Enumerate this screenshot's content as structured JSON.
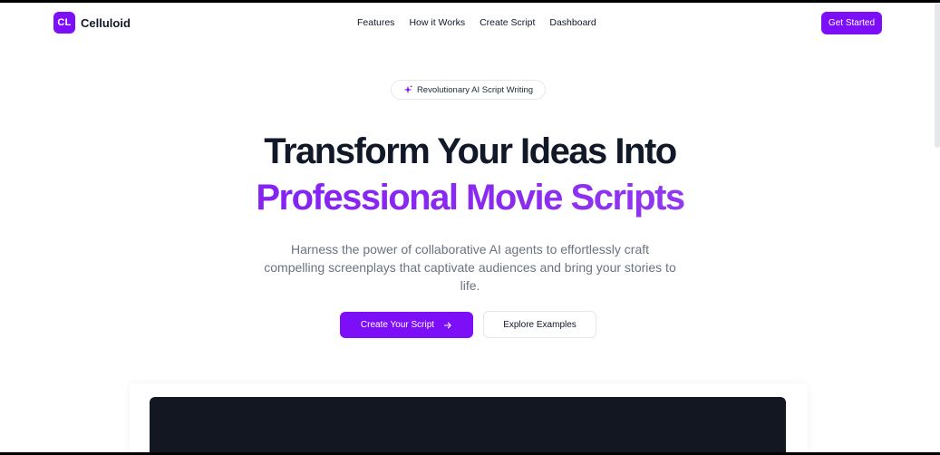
{
  "nav": {
    "logo_badge": "CL",
    "logo_text": "Celluloid",
    "links": [
      "Features",
      "How it Works",
      "Create Script",
      "Dashboard"
    ],
    "cta": "Get Started"
  },
  "hero": {
    "pill_text": "Revolutionary AI Script Writing",
    "pill_icon": "sparkle-icon",
    "headline_line1": "Transform Your Ideas Into",
    "headline_line2": "Professional Movie Scripts",
    "subtext": "Harness the power of collaborative AI agents to effortlessly craft compelling screenplays that captivate audiences and bring your stories to life.",
    "primary_button": "Create Your Script",
    "primary_icon": "arrow-right-icon",
    "secondary_button": "Explore Examples"
  },
  "colors": {
    "brand": "#7c0ff7",
    "heading": "#111827",
    "body_text": "#6b7280",
    "preview_bg": "#131722"
  }
}
